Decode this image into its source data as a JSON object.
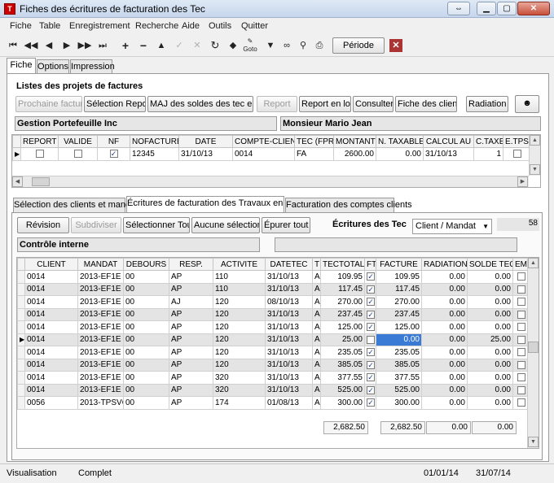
{
  "window": {
    "title": "Fiches des écritures de facturation des Tec",
    "app_icon_text": "T"
  },
  "menu": [
    "Fiche",
    "Table",
    "Enregistrement",
    "Recherche",
    "Aide",
    "Outils",
    "Quitter"
  ],
  "toolbar": {
    "goto_label": "Goto",
    "periode_label": "Période"
  },
  "tabs": {
    "main": [
      "Fiche",
      "Options",
      "Impression"
    ]
  },
  "top_section": {
    "title": "Listes des projets de factures",
    "buttons": [
      "Prochaine facture",
      "Sélection Report",
      "MAJ des soldes des tec en lot",
      "Report",
      "Report en lot",
      "Consulter",
      "Fiche des clients",
      "Radiation"
    ],
    "company": "Gestion Portefeuille Inc",
    "contact": "Monsieur Mario Jean",
    "columns": [
      "REPORT",
      "VALIDE",
      "NF",
      "NOFACTURE",
      "DATE",
      "COMPTE-CLIENT",
      "TEC (FPR)",
      "MONTANT",
      "N. TAXABLE",
      "CALCUL AU",
      "C.TAXE",
      "E.TPS"
    ],
    "row": {
      "nofacture": "12345",
      "date": "31/10/13",
      "compte": "0014",
      "tec": "FA",
      "montant": "2600.00",
      "ntaxable": "0.00",
      "calcul": "31/10/13",
      "ctaxe": "1"
    }
  },
  "bottom_tabs": [
    "Sélection des clients et mandats",
    "Écritures de facturation des Travaux en cours",
    "Facturation des comptes clients"
  ],
  "bottom_section": {
    "buttons": [
      "Révision",
      "Subdiviser",
      "Sélectionner Tout",
      "Aucune sélection",
      "Épurer tout"
    ],
    "ecritures_label": "Écritures des Tec",
    "select_value": "Client / Mandat",
    "count": "58",
    "control_label": "Contrôle interne",
    "columns": [
      "CLIENT",
      "MANDAT",
      "DEBOURS",
      "RESP.",
      "ACTIVITE",
      "DATETEC",
      "T",
      "TECTOTAL",
      "FT",
      "FACTURE",
      "RADIATION",
      "SOLDE TEC",
      "EM"
    ],
    "rows": [
      {
        "client": "0014",
        "mandat": "2013-EF1E",
        "debours": "00",
        "resp": "AP",
        "activite": "110",
        "datetec": "31/10/13",
        "t": "A",
        "tectotal": "109.95",
        "ft": true,
        "facture": "109.95",
        "radiation": "0.00",
        "solde": "0.00"
      },
      {
        "client": "0014",
        "mandat": "2013-EF1E",
        "debours": "00",
        "resp": "AP",
        "activite": "110",
        "datetec": "31/10/13",
        "t": "A",
        "tectotal": "117.45",
        "ft": true,
        "facture": "117.45",
        "radiation": "0.00",
        "solde": "0.00"
      },
      {
        "client": "0014",
        "mandat": "2013-EF1E",
        "debours": "00",
        "resp": "AJ",
        "activite": "120",
        "datetec": "08/10/13",
        "t": "A",
        "tectotal": "270.00",
        "ft": true,
        "facture": "270.00",
        "radiation": "0.00",
        "solde": "0.00"
      },
      {
        "client": "0014",
        "mandat": "2013-EF1E",
        "debours": "00",
        "resp": "AP",
        "activite": "120",
        "datetec": "31/10/13",
        "t": "A",
        "tectotal": "237.45",
        "ft": true,
        "facture": "237.45",
        "radiation": "0.00",
        "solde": "0.00"
      },
      {
        "client": "0014",
        "mandat": "2013-EF1E",
        "debours": "00",
        "resp": "AP",
        "activite": "120",
        "datetec": "31/10/13",
        "t": "A",
        "tectotal": "125.00",
        "ft": true,
        "facture": "125.00",
        "radiation": "0.00",
        "solde": "0.00"
      },
      {
        "client": "0014",
        "mandat": "2013-EF1E",
        "debours": "00",
        "resp": "AP",
        "activite": "120",
        "datetec": "31/10/13",
        "t": "A",
        "tectotal": "25.00",
        "ft": false,
        "facture": "0.00",
        "radiation": "0.00",
        "solde": "25.00"
      },
      {
        "client": "0014",
        "mandat": "2013-EF1E",
        "debours": "00",
        "resp": "AP",
        "activite": "120",
        "datetec": "31/10/13",
        "t": "A",
        "tectotal": "235.05",
        "ft": true,
        "facture": "235.05",
        "radiation": "0.00",
        "solde": "0.00"
      },
      {
        "client": "0014",
        "mandat": "2013-EF1E",
        "debours": "00",
        "resp": "AP",
        "activite": "120",
        "datetec": "31/10/13",
        "t": "A",
        "tectotal": "385.05",
        "ft": true,
        "facture": "385.05",
        "radiation": "0.00",
        "solde": "0.00"
      },
      {
        "client": "0014",
        "mandat": "2013-EF1E",
        "debours": "00",
        "resp": "AP",
        "activite": "320",
        "datetec": "31/10/13",
        "t": "A",
        "tectotal": "377.55",
        "ft": true,
        "facture": "377.55",
        "radiation": "0.00",
        "solde": "0.00"
      },
      {
        "client": "0014",
        "mandat": "2013-EF1E",
        "debours": "00",
        "resp": "AP",
        "activite": "320",
        "datetec": "31/10/13",
        "t": "A",
        "tectotal": "525.00",
        "ft": true,
        "facture": "525.00",
        "radiation": "0.00",
        "solde": "0.00"
      },
      {
        "client": "0056",
        "mandat": "2013-TPSVQ",
        "debours": "00",
        "resp": "AP",
        "activite": "174",
        "datetec": "01/08/13",
        "t": "A",
        "tectotal": "300.00",
        "ft": true,
        "facture": "300.00",
        "radiation": "0.00",
        "solde": "0.00"
      }
    ],
    "totals": {
      "tectotal": "2,682.50",
      "facture": "2,682.50",
      "radiation": "0.00",
      "solde": "0.00"
    }
  },
  "status": {
    "mode": "Visualisation",
    "state": "Complet",
    "date_from": "01/01/14",
    "date_to": "31/07/14"
  },
  "colors": {
    "selection": "#3a7bd5",
    "alt_row": "#e4e4e4"
  }
}
